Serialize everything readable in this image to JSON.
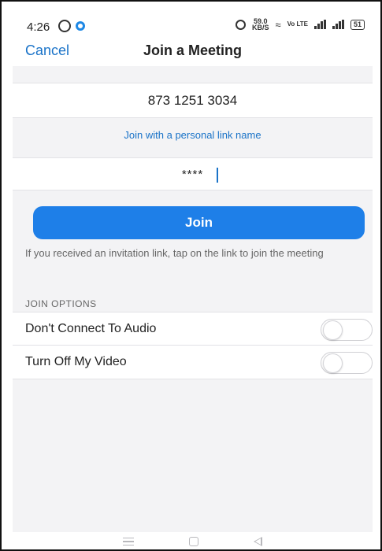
{
  "status_bar": {
    "time": "4:26",
    "speed_value": "59.0",
    "speed_unit": "KB/S",
    "volte": "Vo LTE",
    "battery": "51"
  },
  "header": {
    "cancel_label": "Cancel",
    "title": "Join a Meeting"
  },
  "meeting_id": {
    "value": "873 1251 3034"
  },
  "personal_link_label": "Join with a personal link name",
  "passcode": {
    "value": "****"
  },
  "join_button_label": "Join",
  "hint_text": "If you received an invitation link, tap on the link to join the meeting",
  "join_options": {
    "header": "JOIN OPTIONS",
    "items": [
      {
        "label": "Don't Connect To Audio",
        "enabled": false
      },
      {
        "label": "Turn Off My Video",
        "enabled": false
      }
    ]
  },
  "colors": {
    "accent": "#1e7fe8",
    "link": "#1a73c8",
    "background": "#f3f3f5"
  },
  "icons": {
    "status_left": [
      "whatsapp-icon",
      "notification-dot-icon"
    ],
    "status_right": [
      "alarm-icon",
      "wifi-icon",
      "signal-icon",
      "battery-icon"
    ],
    "system_nav": [
      "menu-icon",
      "home-icon",
      "back-icon"
    ]
  }
}
